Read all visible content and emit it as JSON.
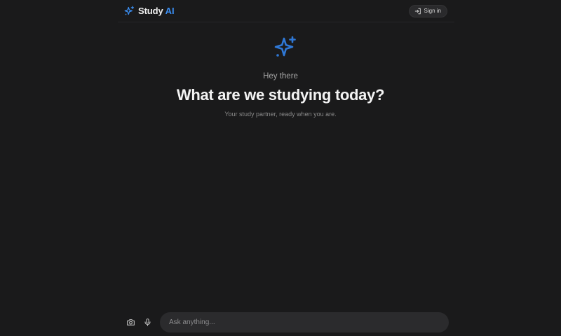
{
  "header": {
    "brand": {
      "name": "Study",
      "accent": "AI"
    },
    "signin_label": "Sign in"
  },
  "hero": {
    "greeting": "Hey there",
    "headline": "What are we studying today?",
    "subline": "Your study partner, ready when you are."
  },
  "composer": {
    "placeholder": "Ask anything..."
  },
  "icons": {
    "logo": "sparkles-icon",
    "signin": "sign-in-icon",
    "hero": "sparkles-icon",
    "camera": "camera-icon",
    "mic": "microphone-icon"
  },
  "colors": {
    "background": "#1a1a1b",
    "accent": "#3b8ff3",
    "hero_icon": "#2f78d6",
    "input_bg": "#2b2b2d"
  }
}
